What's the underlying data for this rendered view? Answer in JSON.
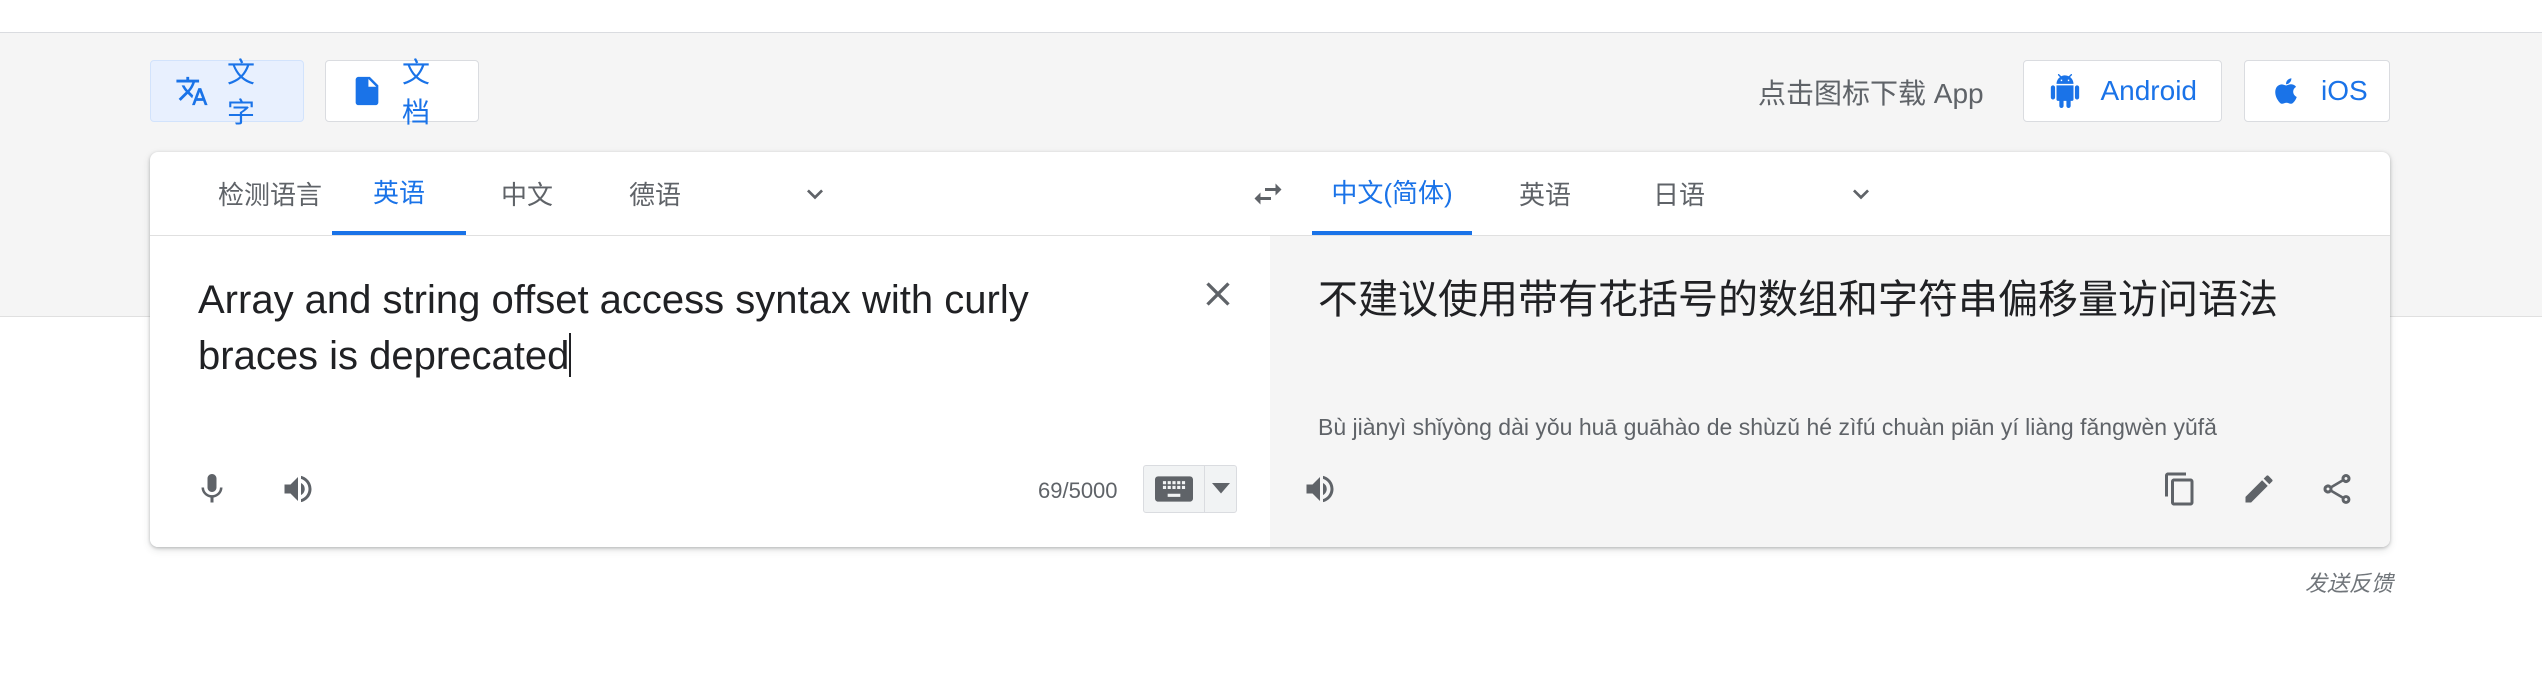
{
  "modes": {
    "text_label": "文字",
    "document_label": "文档"
  },
  "download": {
    "prompt": "点击图标下载 App",
    "android_label": "Android",
    "ios_label": "iOS"
  },
  "source_languages": [
    "检测语言",
    "英语",
    "中文",
    "德语"
  ],
  "source_selected": "英语",
  "target_languages": [
    "中文(简体)",
    "英语",
    "日语"
  ],
  "target_selected": "中文(简体)",
  "source": {
    "text": "Array and string offset access syntax with curly braces is deprecated",
    "char_count": "69/5000"
  },
  "target": {
    "text": "不建议使用带有花括号的数组和字符串偏移量访问语法",
    "pinyin": "Bù jiànyì shǐyòng dài yǒu huā guāhào de shùzǔ hé zìfú chuàn piān yí liàng fǎngwèn yǔfǎ"
  },
  "footer": {
    "feedback": "发送反馈"
  },
  "colors": {
    "accent": "#1a73e8",
    "active_mode_bg": "#e8f0fe",
    "gray_band": "#f5f5f5"
  },
  "icons": {
    "text_mode": "translate-icon",
    "document_mode": "document-icon",
    "android": "android-icon",
    "ios": "apple-icon",
    "swap": "swap-languages-icon",
    "clear": "close-icon",
    "mic": "microphone-icon",
    "speak": "speaker-icon",
    "keyboard": "keyboard-icon",
    "copy": "copy-icon",
    "edit": "pencil-icon",
    "share": "share-icon"
  }
}
